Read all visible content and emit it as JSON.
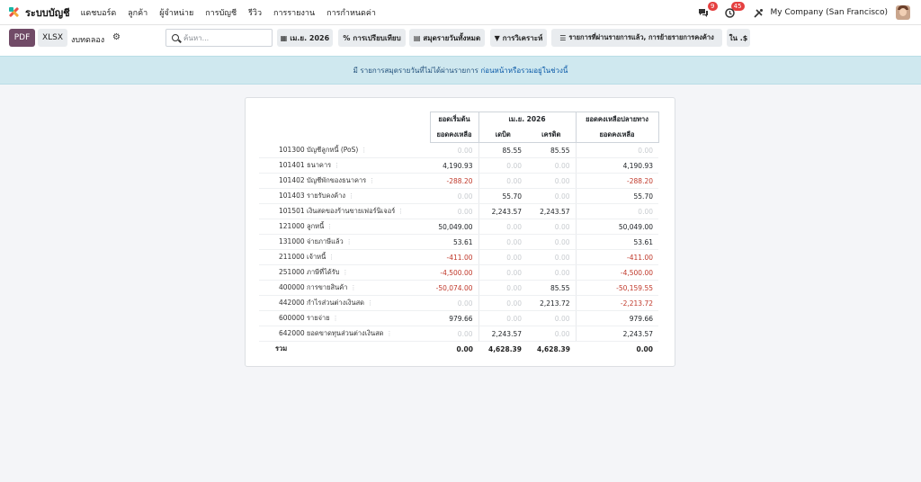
{
  "navbar": {
    "app_name": "ระบบบัญชี",
    "menu": [
      "แดชบอร์ด",
      "ลูกค้า",
      "ผู้จำหน่าย",
      "การบัญชี",
      "รีวิว",
      "การรายงาน",
      "การกำหนดค่า"
    ],
    "messages_badge": "9",
    "activity_badge": "45",
    "company": "My Company (San Francisco)"
  },
  "toolbar": {
    "pdf_label": "PDF",
    "xlsx_label": "XLSX",
    "title": "งบทดลอง",
    "search_placeholder": "ค้นหา...",
    "date_filter": "เม.ย. 2026",
    "comparison": "การเปรียบเทียบ",
    "journals": "สมุดรายวันทั้งหมด",
    "analytic": "การวิเคราะห์",
    "entries_option": "รายการที่ผ่านรายการแล้ว, การย้ายรายการคงค้าง",
    "currency": "ใน .$"
  },
  "banner": {
    "text": "มี รายการสมุดรายวันที่ไม่ได้ผ่านรายการ",
    "link": "ก่อนหน้าหรือรวมอยู่ในช่วงนี้"
  },
  "report": {
    "headers": {
      "initial": "ยอดเริ่มต้น",
      "period": "เม.ย. 2026",
      "end": "ยอดคงเหลือปลายทาง",
      "balance": "ยอดคงเหลือ",
      "debit": "เดบิต",
      "credit": "เครดิต",
      "end_balance": "ยอดคงเหลือ"
    },
    "rows": [
      {
        "account": "101300 บัญชีลูกหนี้ (PoS)",
        "initial": "0.00",
        "debit": "85.55",
        "credit": "85.55",
        "end": "0.00"
      },
      {
        "account": "101401 ธนาคาร",
        "initial": "4,190.93",
        "debit": "0.00",
        "credit": "0.00",
        "end": "4,190.93"
      },
      {
        "account": "101402 บัญชีพักของธนาคาร",
        "initial": "-288.20",
        "debit": "0.00",
        "credit": "0.00",
        "end": "-288.20"
      },
      {
        "account": "101403 รายรับคงค้าง",
        "initial": "0.00",
        "debit": "55.70",
        "credit": "0.00",
        "end": "55.70"
      },
      {
        "account": "101501 เงินสดของร้านขายเฟอร์นิเจอร์",
        "initial": "0.00",
        "debit": "2,243.57",
        "credit": "2,243.57",
        "end": "0.00"
      },
      {
        "account": "121000 ลูกหนี้",
        "initial": "50,049.00",
        "debit": "0.00",
        "credit": "0.00",
        "end": "50,049.00"
      },
      {
        "account": "131000 จ่ายภาษีแล้ว",
        "initial": "53.61",
        "debit": "0.00",
        "credit": "0.00",
        "end": "53.61"
      },
      {
        "account": "211000 เจ้าหนี้",
        "initial": "-411.00",
        "debit": "0.00",
        "credit": "0.00",
        "end": "-411.00"
      },
      {
        "account": "251000 ภาษีที่ได้รับ",
        "initial": "-4,500.00",
        "debit": "0.00",
        "credit": "0.00",
        "end": "-4,500.00"
      },
      {
        "account": "400000 การขายสินค้า",
        "initial": "-50,074.00",
        "debit": "0.00",
        "credit": "85.55",
        "end": "-50,159.55"
      },
      {
        "account": "442000 กำไรส่วนต่างเงินสด",
        "initial": "0.00",
        "debit": "0.00",
        "credit": "2,213.72",
        "end": "-2,213.72"
      },
      {
        "account": "600000 รายจ่าย",
        "initial": "979.66",
        "debit": "0.00",
        "credit": "0.00",
        "end": "979.66"
      },
      {
        "account": "642000 ยอดขาดทุนส่วนต่างเงินสด",
        "initial": "0.00",
        "debit": "2,243.57",
        "credit": "0.00",
        "end": "2,243.57"
      }
    ],
    "total": {
      "label": "รวม",
      "initial": "0.00",
      "debit": "4,628.39",
      "credit": "4,628.39",
      "end": "0.00"
    }
  },
  "colors": {
    "brand": "#714b67",
    "negative": "#c0392b",
    "banner_bg": "#cfe8ef"
  }
}
